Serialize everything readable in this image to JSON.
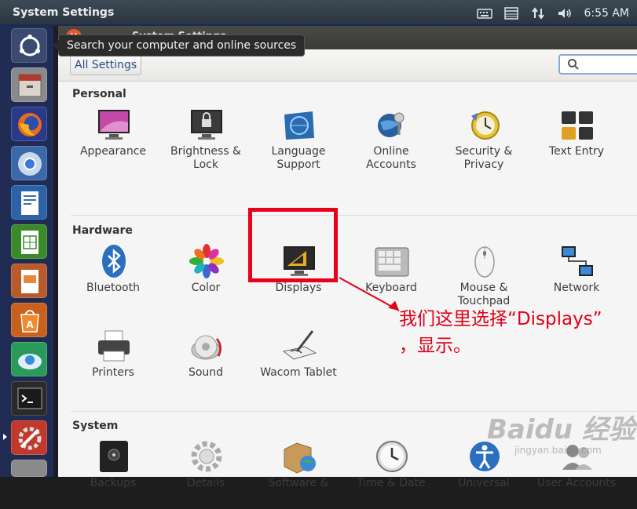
{
  "top_panel": {
    "title": "System Settings",
    "clock": "6:55 AM",
    "indicators": [
      "keyboard-icon",
      "calendar-icon",
      "network-arrows-icon",
      "volume-icon"
    ]
  },
  "launcher": {
    "items": [
      "ubuntu-dash-icon",
      "files-icon",
      "firefox-icon",
      "chromium-icon",
      "writer-icon",
      "calc-icon",
      "impress-icon",
      "software-center-icon",
      "remmina-icon",
      "terminal-icon",
      "system-settings-icon"
    ]
  },
  "tooltip": "Search your computer and online sources",
  "window": {
    "title": "System Settings",
    "close_label": "×"
  },
  "toolbar": {
    "all_settings_label": "All Settings",
    "search_placeholder": ""
  },
  "sections": {
    "personal": {
      "title": "Personal",
      "items": [
        {
          "label": "Appearance",
          "icon": "appearance-icon"
        },
        {
          "label": "Brightness & Lock",
          "icon": "brightness-lock-icon"
        },
        {
          "label": "Language Support",
          "icon": "language-support-icon"
        },
        {
          "label": "Online Accounts",
          "icon": "online-accounts-icon"
        },
        {
          "label": "Security & Privacy",
          "icon": "security-privacy-icon"
        },
        {
          "label": "Text Entry",
          "icon": "text-entry-icon"
        }
      ]
    },
    "hardware": {
      "title": "Hardware",
      "items": [
        {
          "label": "Bluetooth",
          "icon": "bluetooth-icon"
        },
        {
          "label": "Color",
          "icon": "color-icon"
        },
        {
          "label": "Displays",
          "icon": "displays-icon"
        },
        {
          "label": "Keyboard",
          "icon": "keyboard-icon"
        },
        {
          "label": "Mouse & Touchpad",
          "icon": "mouse-icon"
        },
        {
          "label": "Network",
          "icon": "network-icon"
        },
        {
          "label": "Printers",
          "icon": "printer-icon"
        },
        {
          "label": "Sound",
          "icon": "sound-icon"
        },
        {
          "label": "Wacom Tablet",
          "icon": "wacom-tablet-icon"
        }
      ]
    },
    "system": {
      "title": "System",
      "items": [
        {
          "label": "Backups",
          "icon": "backups-icon"
        },
        {
          "label": "Details",
          "icon": "details-icon"
        },
        {
          "label": "Software &",
          "icon": "software-icon"
        },
        {
          "label": "Time & Date",
          "icon": "time-date-icon"
        },
        {
          "label": "Universal",
          "icon": "universal-access-icon"
        },
        {
          "label": "User Accounts",
          "icon": "user-accounts-icon"
        }
      ]
    }
  },
  "annotation": {
    "line1": "我们这里选择“Displays”",
    "line2": "，显示。",
    "color": "#e00018"
  },
  "watermark": {
    "logo": "Baidu 经验",
    "url": "jingyan.baidu.com"
  }
}
